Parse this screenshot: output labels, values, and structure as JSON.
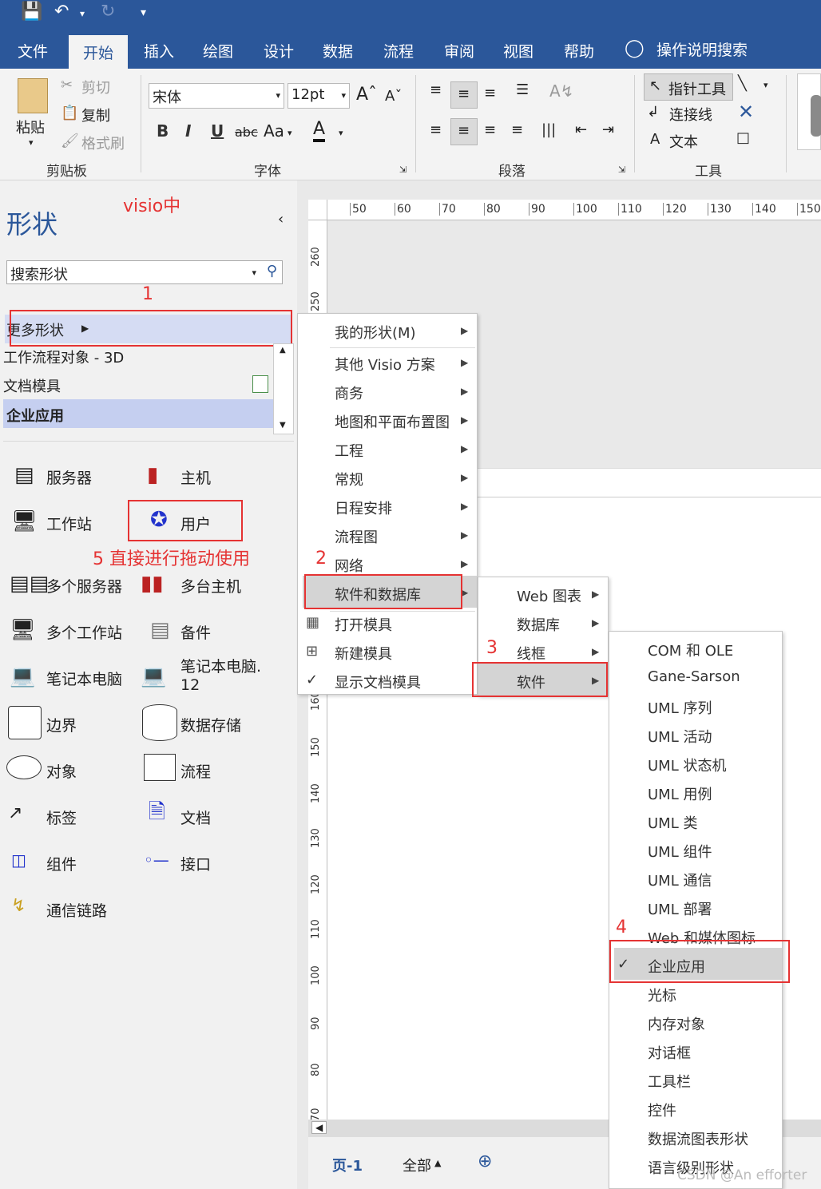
{
  "quick_access": {
    "save_icon": "save-icon",
    "undo_icon": "undo-icon",
    "redo_icon": "redo-icon",
    "customize_icon": "customize-icon"
  },
  "ribbon_tabs": [
    "文件",
    "开始",
    "插入",
    "绘图",
    "设计",
    "数据",
    "流程",
    "审阅",
    "视图",
    "帮助"
  ],
  "tell_me": "操作说明搜索",
  "clipboard": {
    "paste": "粘贴",
    "cut": "剪切",
    "copy": "复制",
    "format_painter": "格式刷",
    "group": "剪贴板"
  },
  "font": {
    "name": "宋体",
    "size": "12pt",
    "bold": "B",
    "italic": "I",
    "underline": "U",
    "strike": "abc",
    "case": "Aa",
    "color": "A",
    "group": "字体"
  },
  "paragraph": {
    "group": "段落"
  },
  "tools": {
    "pointer": "指针工具",
    "connector": "连接线",
    "text": "文本",
    "group": "工具"
  },
  "shapes_pane": {
    "title": "形状",
    "note": "visio中",
    "search_placeholder": "搜索形状",
    "step1": "1",
    "more_shapes": "更多形状",
    "stencils": [
      "工作流程对象 - 3D",
      "文档模具",
      "企业应用"
    ],
    "step5": "5  直接进行拖动使用",
    "items": [
      {
        "label": "服务器",
        "icon": "server-icon"
      },
      {
        "label": "主机",
        "icon": "mainframe-icon"
      },
      {
        "label": "工作站",
        "icon": "workstation-icon"
      },
      {
        "label": "用户",
        "icon": "user-icon"
      },
      {
        "label": "多个服务器",
        "icon": "multiple-servers-icon"
      },
      {
        "label": "多台主机",
        "icon": "multiple-mainframes-icon"
      },
      {
        "label": "多个工作站",
        "icon": "multiple-workstations-icon"
      },
      {
        "label": "备件",
        "icon": "spare-icon"
      },
      {
        "label": "笔记本电脑",
        "icon": "laptop-icon"
      },
      {
        "label": "笔记本电脑.\n12",
        "icon": "laptop-12-icon"
      },
      {
        "label": "边界",
        "icon": "boundary-icon"
      },
      {
        "label": "数据存储",
        "icon": "data-store-icon"
      },
      {
        "label": "对象",
        "icon": "object-icon"
      },
      {
        "label": "流程",
        "icon": "process-icon"
      },
      {
        "label": "标签",
        "icon": "label-icon"
      },
      {
        "label": "文档",
        "icon": "document-icon"
      },
      {
        "label": "组件",
        "icon": "component-icon"
      },
      {
        "label": "接口",
        "icon": "interface-icon"
      },
      {
        "label": "通信链路",
        "icon": "comm-link-icon"
      }
    ]
  },
  "ruler": {
    "h_ticks": [
      "50",
      "60",
      "70",
      "80",
      "90",
      "100",
      "110",
      "120",
      "130",
      "140",
      "150"
    ],
    "v_ticks": [
      "260",
      "250",
      "160",
      "150",
      "140",
      "130",
      "120",
      "110",
      "100",
      "90",
      "80",
      "70"
    ]
  },
  "page_tabs": {
    "page": "页-1",
    "all": "全部"
  },
  "menu1": {
    "items": [
      "我的形状(M)",
      "其他 Visio 方案",
      "商务",
      "地图和平面布置图",
      "工程",
      "常规",
      "日程安排",
      "流程图",
      "网络",
      "软件和数据库"
    ],
    "actions": [
      "打开模具",
      "新建模具",
      "显示文档模具"
    ],
    "step2": "2"
  },
  "menu2": {
    "items": [
      "Web 图表",
      "数据库",
      "线框",
      "软件"
    ],
    "step3": "3"
  },
  "menu3": {
    "items": [
      "COM 和 OLE",
      "Gane-Sarson",
      "UML 序列",
      "UML 活动",
      "UML 状态机",
      "UML 用例",
      "UML 类",
      "UML 组件",
      "UML 通信",
      "UML 部署",
      "Web 和媒体图标",
      "企业应用",
      "光标",
      "内存对象",
      "对话框",
      "工具栏",
      "控件",
      "数据流图表形状",
      "语言级别形状"
    ],
    "step4": "4"
  },
  "watermark": "CSDN @An efforter"
}
